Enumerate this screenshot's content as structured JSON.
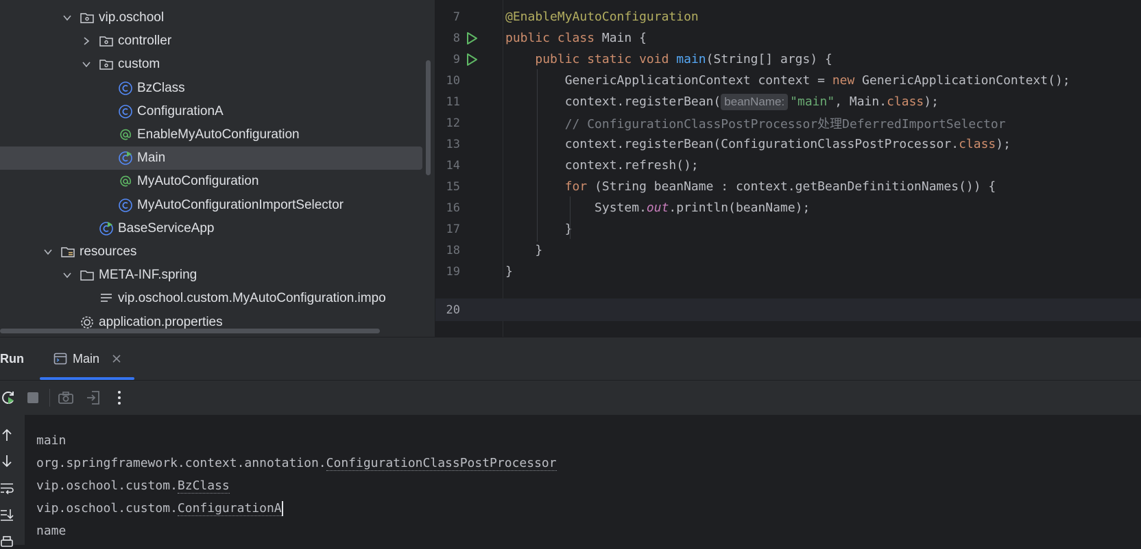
{
  "tree": {
    "items": [
      {
        "label": "vip.oschool",
        "indent": 2,
        "chevron": "down",
        "icon": "package-icon"
      },
      {
        "label": "controller",
        "indent": 3,
        "chevron": "right",
        "icon": "package-icon"
      },
      {
        "label": "custom",
        "indent": 3,
        "chevron": "down",
        "icon": "package-icon"
      },
      {
        "label": "BzClass",
        "indent": 4,
        "chevron": "",
        "icon": "class-icon"
      },
      {
        "label": "ConfigurationA",
        "indent": 4,
        "chevron": "",
        "icon": "class-icon"
      },
      {
        "label": "EnableMyAutoConfiguration",
        "indent": 4,
        "chevron": "",
        "icon": "annotation-icon"
      },
      {
        "label": "Main",
        "indent": 4,
        "chevron": "",
        "icon": "runnable-class-icon",
        "selected": true
      },
      {
        "label": "MyAutoConfiguration",
        "indent": 4,
        "chevron": "",
        "icon": "annotation-icon"
      },
      {
        "label": "MyAutoConfigurationImportSelector",
        "indent": 4,
        "chevron": "",
        "icon": "class-icon"
      },
      {
        "label": "BaseServiceApp",
        "indent": 3,
        "chevron": "",
        "icon": "runnable-class-icon"
      },
      {
        "label": "resources",
        "indent": 1,
        "chevron": "down",
        "icon": "resources-folder-icon"
      },
      {
        "label": "META-INF.spring",
        "indent": 2,
        "chevron": "down",
        "icon": "folder-icon"
      },
      {
        "label": "vip.oschool.custom.MyAutoConfiguration.impo",
        "indent": 3,
        "chevron": "",
        "icon": "text-file-icon"
      },
      {
        "label": "application.properties",
        "indent": 2,
        "chevron": "",
        "icon": "settings-file-icon"
      }
    ]
  },
  "editor": {
    "line_numbers": [
      "7",
      "8",
      "9",
      "10",
      "11",
      "12",
      "13",
      "14",
      "15",
      "16",
      "17",
      "18",
      "19",
      "20"
    ],
    "inlay_hint": "beanName:"
  },
  "run": {
    "label": "Run",
    "tab_label": "Main",
    "output": [
      "main",
      "org.springframework.context.annotation.ConfigurationClassPostProcessor",
      "vip.oschool.custom.BzClass",
      "vip.oschool.custom.ConfigurationA",
      "name"
    ]
  },
  "colors": {
    "background": "#1e1f22",
    "panel": "#2b2d30",
    "accent": "#3574f0",
    "run_green": "#5fb865",
    "keyword": "#cf8e6d",
    "annotation": "#b3ae60",
    "string": "#6aab73"
  }
}
